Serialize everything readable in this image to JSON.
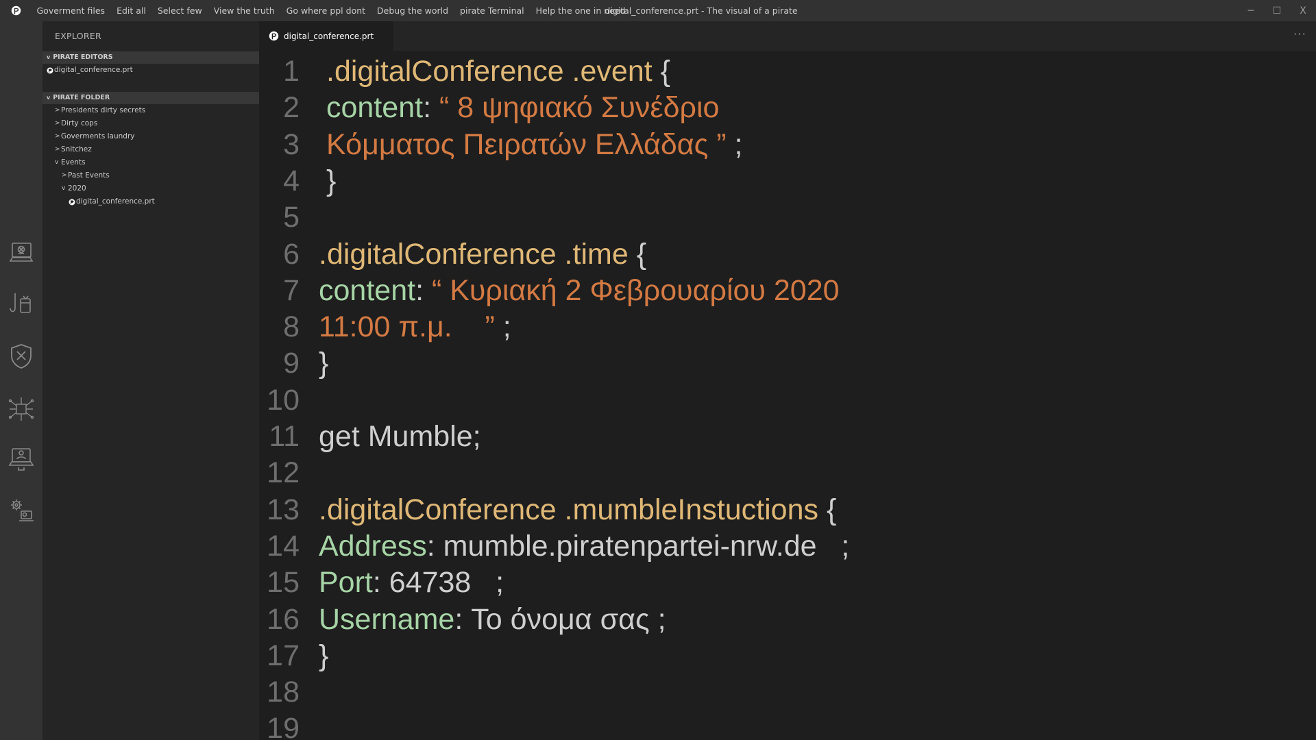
{
  "menubar": {
    "items": [
      "Goverment files",
      "Edit all",
      "Select few",
      "View the truth",
      "Go where ppl dont",
      "Debug the world",
      "pirate Terminal",
      "Help the one in need"
    ],
    "window_title": "digital_conference.prt - The visual of a pirate"
  },
  "window_controls": {
    "minimize": "─",
    "maximize": "☐",
    "close": "X"
  },
  "activity_bar": {
    "icons": [
      "pirate-computer-icon",
      "hook-drink-icon",
      "shield-cross-icon",
      "circuit-board-icon",
      "laptop-user-icon",
      "gears-laptop-icon"
    ]
  },
  "sidebar": {
    "title": "EXPLORER",
    "editors_section": {
      "label": "PIRATE EDITORS",
      "files": [
        "digital_conference.prt"
      ]
    },
    "folder_section": {
      "label": "PIRATE FOLDER",
      "items": [
        {
          "label": "Presidents dirty secrets",
          "twisty": ">"
        },
        {
          "label": "Dirty cops",
          "twisty": ">"
        },
        {
          "label": "Goverments laundry",
          "twisty": ">"
        },
        {
          "label": "Snitchez",
          "twisty": ">"
        },
        {
          "label": "Events",
          "twisty": "v"
        },
        {
          "label": "Past Events",
          "twisty": ">"
        },
        {
          "label": "2020",
          "twisty": "v"
        },
        {
          "label": "digital_conference.prt",
          "twisty": ""
        }
      ]
    }
  },
  "editor": {
    "tab_label": "digital_conference.prt",
    "more_actions": "···",
    "line_numbers": [
      "1",
      "2",
      "3",
      "4",
      "5",
      "6",
      "7",
      "8",
      "9",
      "10",
      "11",
      "12",
      "13",
      "14",
      "15",
      "16",
      "17",
      "18",
      "19"
    ],
    "lines": [
      [
        {
          "t": ".digitalConference .event ",
          "c": "sel"
        },
        {
          "t": "{",
          "c": "punc"
        }
      ],
      [
        {
          "t": "content",
          "c": "prop"
        },
        {
          "t": ": ",
          "c": "punc"
        },
        {
          "t": "“ 8 ψηφιακό Συνέδριο",
          "c": "str"
        }
      ],
      [
        {
          "t": "Κόμματος Πειρατών Ελλάδας ”",
          "c": "str"
        },
        {
          "t": " ;",
          "c": "punc"
        }
      ],
      [
        {
          "t": "}",
          "c": "punc"
        }
      ],
      [],
      [
        {
          "t": ".digitalConference .time ",
          "c": "sel"
        },
        {
          "t": "{",
          "c": "punc"
        }
      ],
      [
        {
          "t": "content",
          "c": "prop"
        },
        {
          "t": ": ",
          "c": "punc"
        },
        {
          "t": "“ Κυριακή 2 Φεβρουαρίου 2020",
          "c": "str"
        }
      ],
      [
        {
          "t": "11:00 π.μ.    ”",
          "c": "str"
        },
        {
          "t": " ;",
          "c": "punc"
        }
      ],
      [
        {
          "t": "}",
          "c": "punc"
        }
      ],
      [],
      [
        {
          "t": "get Mumble;",
          "c": "text"
        }
      ],
      [],
      [
        {
          "t": ".digitalConference .mumbleInstuctions ",
          "c": "sel"
        },
        {
          "t": "{",
          "c": "punc"
        }
      ],
      [
        {
          "t": "Address",
          "c": "prop"
        },
        {
          "t": ": mumble.piratenpartei-nrw.de   ;",
          "c": "text"
        }
      ],
      [
        {
          "t": "Port",
          "c": "prop"
        },
        {
          "t": ": 64738   ;",
          "c": "text"
        }
      ],
      [
        {
          "t": "Username",
          "c": "prop"
        },
        {
          "t": ": Το όνομα σας ;",
          "c": "text"
        }
      ],
      [
        {
          "t": "}",
          "c": "punc"
        }
      ],
      [],
      []
    ]
  }
}
